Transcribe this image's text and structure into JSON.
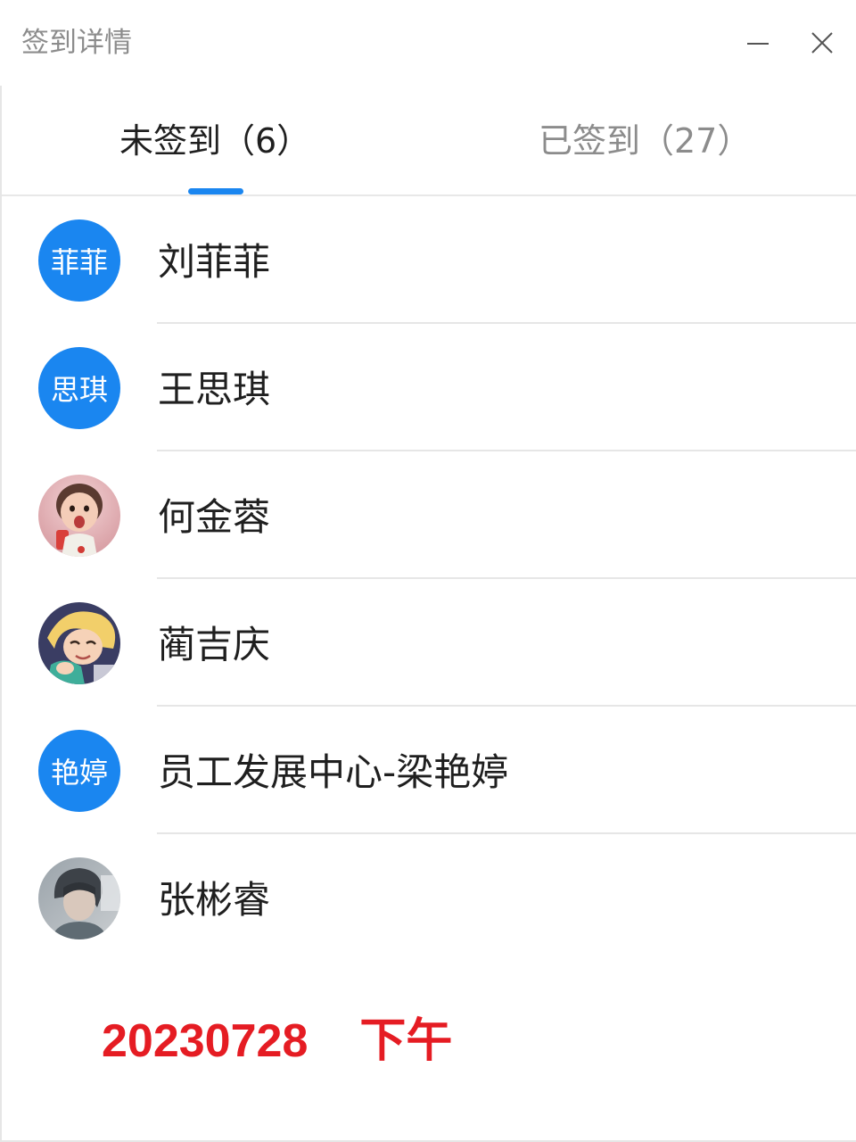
{
  "window": {
    "title": "签到详情"
  },
  "controls": {
    "minimize_icon": "minimize-icon",
    "close_icon": "close-icon"
  },
  "tabs": [
    {
      "label": "未签到（6）",
      "active": true
    },
    {
      "label": "已签到（27）",
      "active": false
    }
  ],
  "colors": {
    "accent": "#1a86f0",
    "annotation": "#e51c23"
  },
  "members": [
    {
      "name": "刘菲菲",
      "avatar_text": "菲菲",
      "avatar_type": "text"
    },
    {
      "name": "王思琪",
      "avatar_text": "思琪",
      "avatar_type": "text"
    },
    {
      "name": "何金蓉",
      "avatar_type": "photo"
    },
    {
      "name": "蔺吉庆",
      "avatar_type": "photo"
    },
    {
      "name": "员工发展中心-梁艳婷",
      "avatar_text": "艳婷",
      "avatar_type": "text"
    },
    {
      "name": "张彬睿",
      "avatar_type": "photo"
    }
  ],
  "annotation": {
    "date": "20230728",
    "period": "下午"
  }
}
